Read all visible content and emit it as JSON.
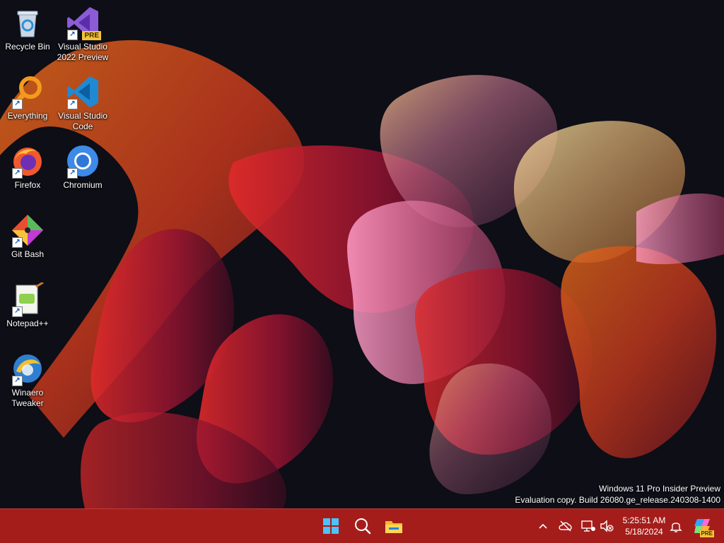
{
  "desktop": {
    "icons": [
      {
        "label": "Recycle Bin",
        "icon": "recycle-bin-icon",
        "shortcut": false
      },
      {
        "label": "Visual Studio 2022 Preview",
        "icon": "visual-studio-icon",
        "shortcut": true,
        "badge": "PRE"
      },
      {
        "label": "Everything",
        "icon": "everything-search-icon",
        "shortcut": true
      },
      {
        "label": "Visual Studio Code",
        "icon": "vscode-icon",
        "shortcut": true
      },
      {
        "label": "Firefox",
        "icon": "firefox-icon",
        "shortcut": true
      },
      {
        "label": "Chromium",
        "icon": "chromium-icon",
        "shortcut": true
      },
      {
        "label": "Git Bash",
        "icon": "git-bash-icon",
        "shortcut": true
      },
      {
        "label": "Notepad++",
        "icon": "notepad-plus-plus-icon",
        "shortcut": true
      },
      {
        "label": "Winaero Tweaker",
        "icon": "winaero-tweaker-icon",
        "shortcut": true
      }
    ]
  },
  "watermark": {
    "line1": "Windows 11 Pro Insider Preview",
    "line2": "Evaluation copy. Build 26080.ge_release.240308-1400"
  },
  "taskbar": {
    "color": "#a51d1a",
    "pinned": [
      "start-icon",
      "search-icon",
      "file-explorer-icon"
    ],
    "tray": [
      "chevron-up-icon",
      "onedrive-offline-icon",
      "network-icon",
      "volume-muted-icon"
    ],
    "clock": {
      "time": "5:25:51 AM",
      "date": "5/18/2024"
    },
    "notifications_icon": "bell-icon",
    "copilot_badge": "PRE"
  }
}
